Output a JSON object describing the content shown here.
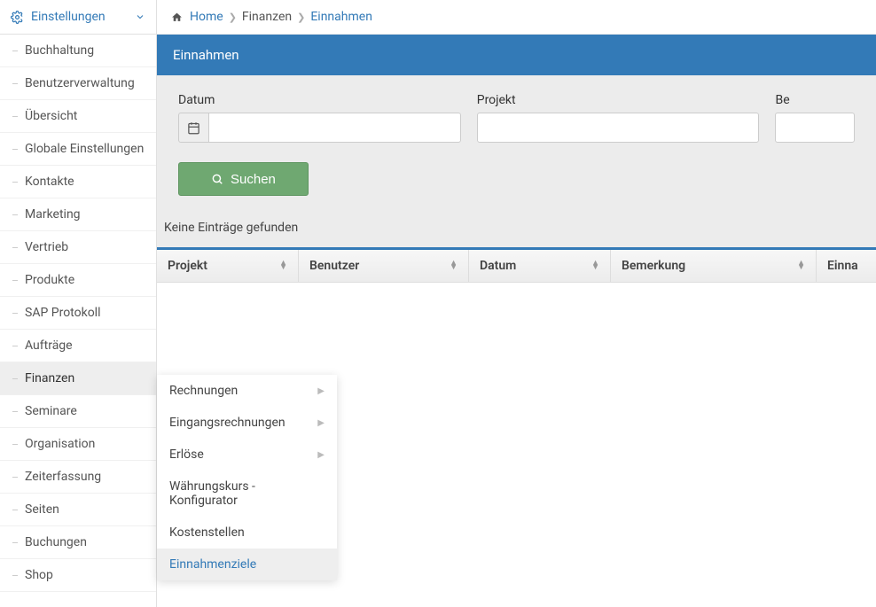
{
  "sidebar": {
    "header": "Einstellungen",
    "items": [
      {
        "label": "Buchhaltung"
      },
      {
        "label": "Benutzerverwaltung"
      },
      {
        "label": "Übersicht"
      },
      {
        "label": "Globale Einstellungen"
      },
      {
        "label": "Kontakte"
      },
      {
        "label": "Marketing"
      },
      {
        "label": "Vertrieb"
      },
      {
        "label": "Produkte"
      },
      {
        "label": "SAP Protokoll"
      },
      {
        "label": "Aufträge"
      },
      {
        "label": "Finanzen",
        "active": true
      },
      {
        "label": "Seminare"
      },
      {
        "label": "Organisation"
      },
      {
        "label": "Zeiterfassung"
      },
      {
        "label": "Seiten"
      },
      {
        "label": "Buchungen"
      },
      {
        "label": "Shop"
      }
    ]
  },
  "submenu": {
    "items": [
      {
        "label": "Rechnungen",
        "children": true
      },
      {
        "label": "Eingangsrechnungen",
        "children": true
      },
      {
        "label": "Erlöse",
        "children": true
      },
      {
        "label": "Währungskurs - Konfigurator"
      },
      {
        "label": "Kostenstellen"
      },
      {
        "label": "Einnahmenziele",
        "highlight": true
      }
    ]
  },
  "breadcrumb": {
    "home": "Home",
    "level1": "Finanzen",
    "level2": "Einnahmen"
  },
  "panel": {
    "title": "Einnahmen"
  },
  "filters": {
    "datum_label": "Datum",
    "projekt_label": "Projekt",
    "bem_label": "Be",
    "search_label": "Suchen",
    "datum_value": "",
    "projekt_value": ""
  },
  "results": {
    "empty_text": "Keine Einträge gefunden"
  },
  "table": {
    "columns": {
      "projekt": "Projekt",
      "benutzer": "Benutzer",
      "datum": "Datum",
      "bemerkung": "Bemerkung",
      "einnahme": "Einna"
    }
  }
}
